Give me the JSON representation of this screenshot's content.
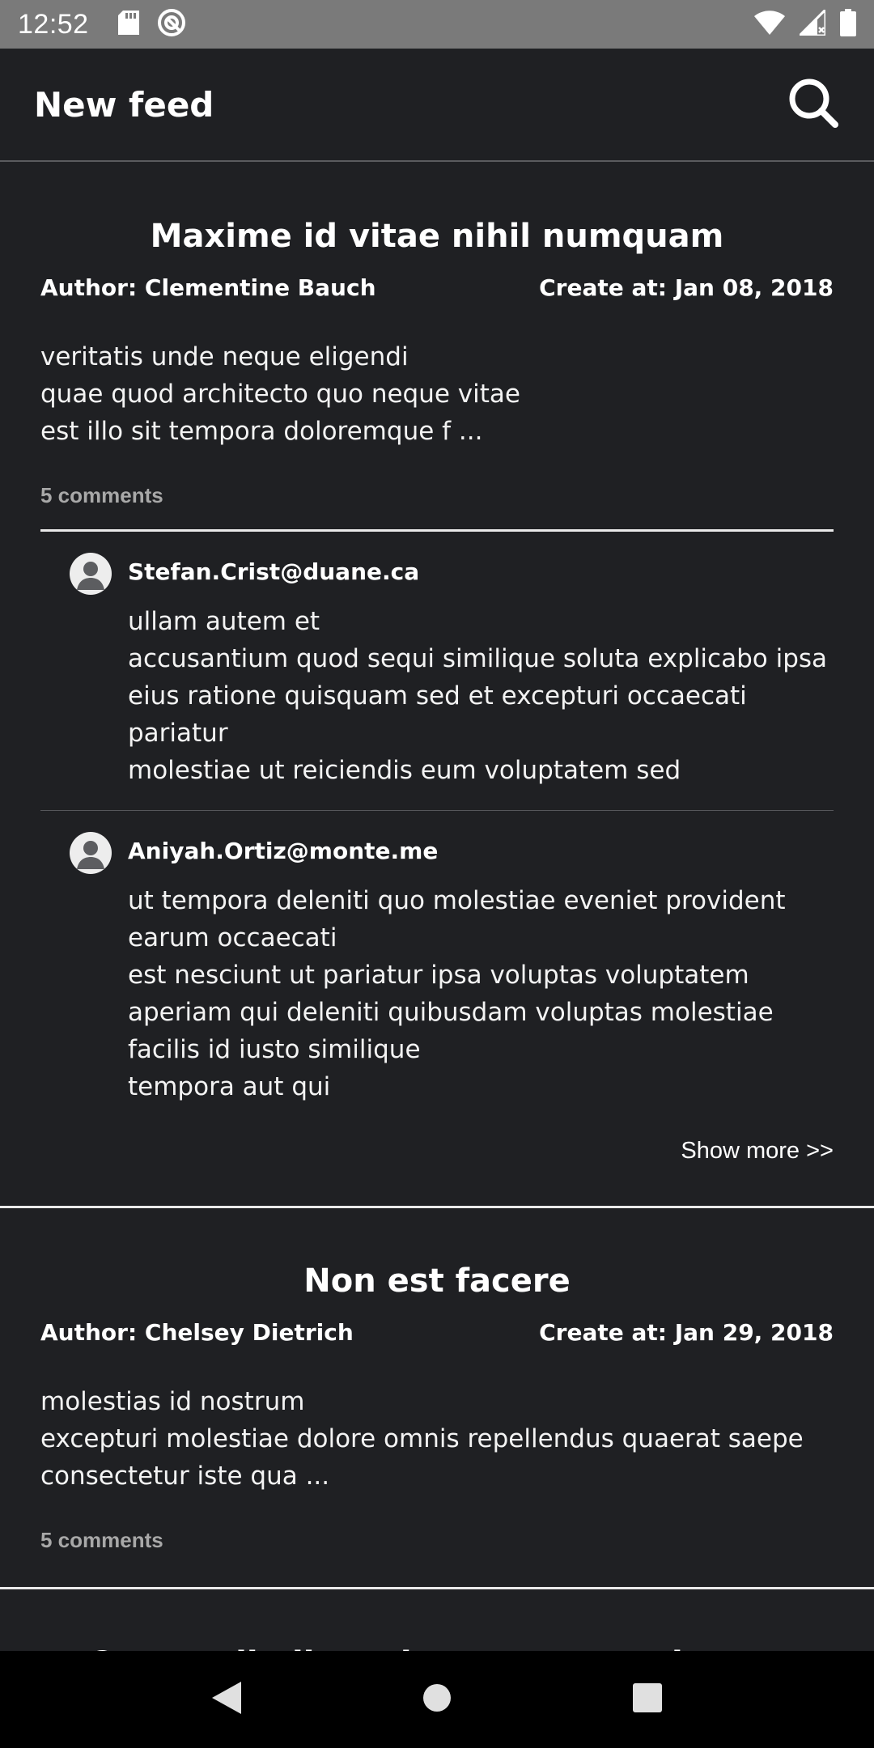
{
  "status_bar": {
    "time": "12:52",
    "left_icons": [
      "sd-card-icon",
      "sync-icon"
    ],
    "right_icons": [
      "wifi-icon",
      "cellular-signal-icon",
      "battery-icon"
    ]
  },
  "app_bar": {
    "title": "New feed",
    "search_icon": "search-icon"
  },
  "posts": [
    {
      "title": "Maxime id vitae nihil numquam",
      "author": "Author: Clementine Bauch",
      "created": "Create at: Jan 08, 2018",
      "body": "veritatis unde neque eligendi\nquae quod architecto quo neque vitae\nest illo sit tempora doloremque f ...",
      "comment_count": "5 comments",
      "comments": [
        {
          "email": "Stefan.Crist@duane.ca",
          "text": "ullam autem et\naccusantium quod sequi similique soluta explicabo ipsa\neius ratione quisquam sed et excepturi occaecati pariatur\nmolestiae ut reiciendis eum voluptatem sed"
        },
        {
          "email": "Aniyah.Ortiz@monte.me",
          "text": "ut tempora deleniti quo molestiae eveniet provident earum occaecati\nest nesciunt ut pariatur ipsa voluptas voluptatem aperiam qui deleniti quibusdam voluptas molestiae facilis id iusto similique\ntempora aut qui"
        }
      ],
      "show_more": "Show more >>"
    },
    {
      "title": "Non est facere",
      "author": "Author: Chelsey Dietrich",
      "created": "Create at: Jan 29, 2018",
      "body": "molestias id nostrum\nexcepturi molestiae dolore omnis repellendus quaerat saepe\nconsectetur iste qua ...",
      "comment_count": "5 comments"
    },
    {
      "title": "Commodi ullam sint et excepturi error explicabo"
    }
  ],
  "nav_bar": {
    "icons": [
      "back-icon",
      "home-icon",
      "recents-icon"
    ]
  }
}
